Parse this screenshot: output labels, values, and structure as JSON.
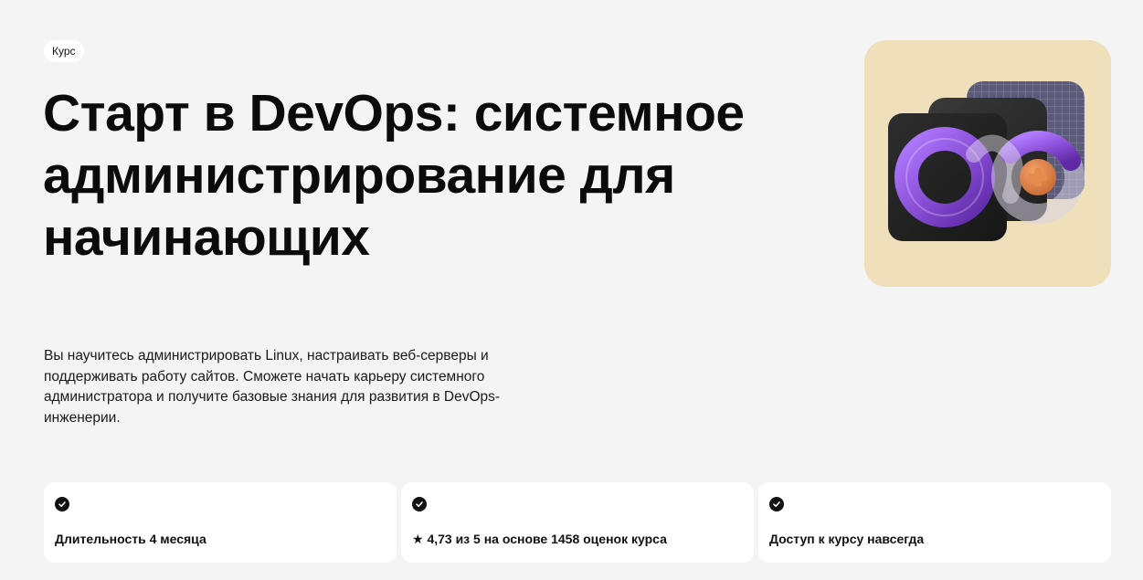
{
  "badge": {
    "label": "Курс"
  },
  "hero": {
    "title": "Старт в DevOps: системное администрирование для начинающих",
    "description": "Вы научитесь администрировать Linux, настраивать веб-серверы и поддерживать работу сайтов. Сможете начать карьеру системного администратора и получите базовые знания для развития в DevOps-инженерии."
  },
  "cover": {
    "icon": "devops-infinity-illustration",
    "background": "#efdfba",
    "accent": "#8b4fd8"
  },
  "facts": [
    {
      "icon": "check-circle-icon",
      "text": "Длительность 4 месяца"
    },
    {
      "icon": "check-circle-icon",
      "text": "★ 4,73 из 5 на основе 1458 оценок курса"
    },
    {
      "icon": "check-circle-icon",
      "text": "Доступ к курсу навсегда"
    }
  ]
}
